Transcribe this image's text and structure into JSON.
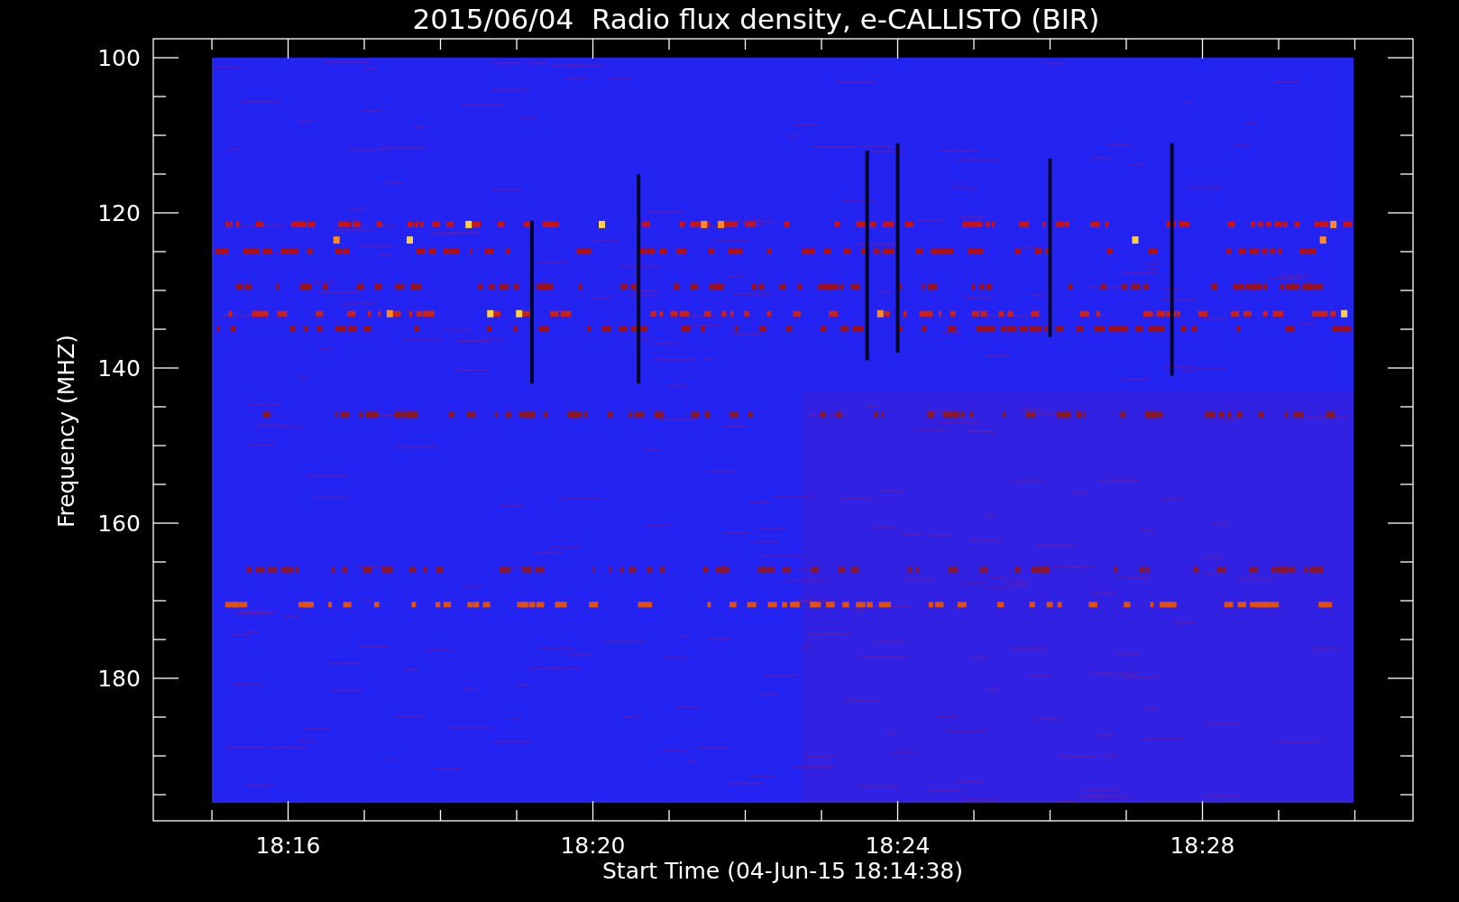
{
  "title": "2015/06/04  Radio flux density, e-CALLISTO (BIR)",
  "y_axis": {
    "label": "Frequency (MHZ)",
    "ticks": [
      "100",
      "120",
      "140",
      "160",
      "180"
    ]
  },
  "x_axis": {
    "label": "Start Time (04-Jun-15 18:14:38)",
    "ticks": [
      "18:16",
      "18:20",
      "18:24",
      "18:28"
    ]
  }
}
